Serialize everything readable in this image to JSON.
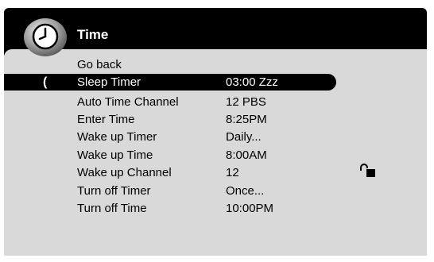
{
  "header": {
    "title": "Time",
    "icon": "clock-icon"
  },
  "menu": {
    "items": [
      {
        "label": "Go back",
        "value": ""
      },
      {
        "label": "Sleep Timer",
        "value": "03:00 Zzz",
        "selected": true,
        "marker": "("
      },
      {
        "label": "Auto Time Channel",
        "value": "12 PBS"
      },
      {
        "label": "Enter Time",
        "value": "8:25PM"
      },
      {
        "label": "Wake up Timer",
        "value": "Daily..."
      },
      {
        "label": "Wake up Time",
        "value": "8:00AM"
      },
      {
        "label": "Wake up Channel",
        "value": "12",
        "status_icon": "unlocked-padlock-icon"
      },
      {
        "label": "Turn off Timer",
        "value": "Once..."
      },
      {
        "label": "Turn off Time",
        "value": "10:00PM"
      }
    ]
  },
  "colors": {
    "background": "#ffffff",
    "header": "#000000",
    "panel": "#d9d9d9",
    "selection": "#000000",
    "text": "#000000",
    "selected_text": "#ffffff"
  }
}
